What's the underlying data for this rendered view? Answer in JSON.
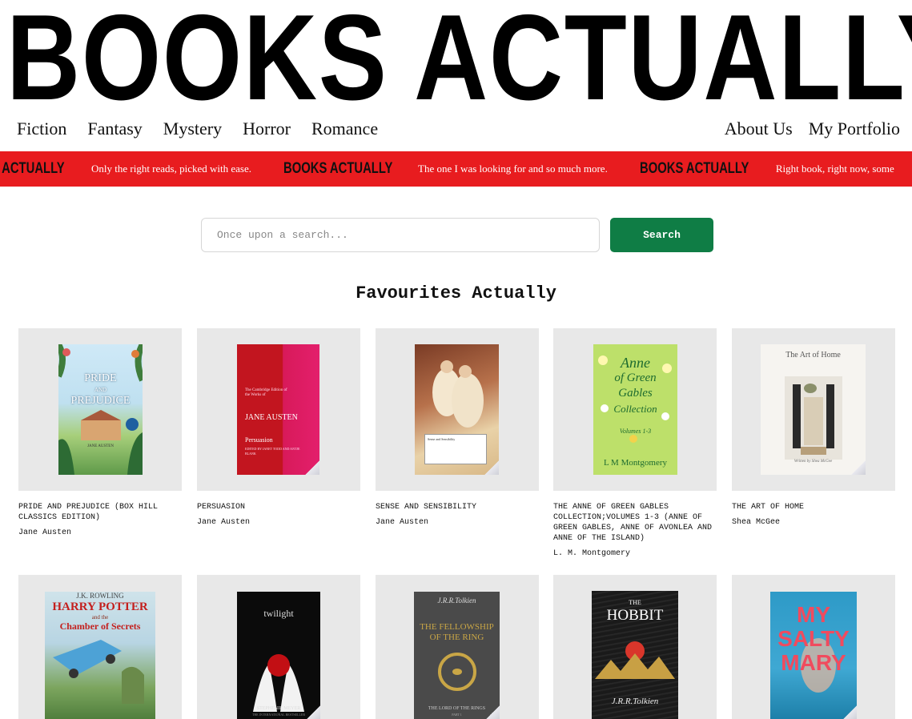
{
  "site": {
    "title": "BOOKS ACTUALLY"
  },
  "nav": {
    "left": [
      "Fiction",
      "Fantasy",
      "Mystery",
      "Horror",
      "Romance"
    ],
    "right": [
      "About Us",
      "My Portfolio"
    ]
  },
  "ticker": {
    "brand": "BOOKS ACTUALLY",
    "brand_partial": "KS ACTUALLY",
    "taglines": [
      "Only the right reads, picked with ease.",
      "The one I was looking for and so much more.",
      "Right book, right now, some"
    ]
  },
  "search": {
    "placeholder": "Once upon a search...",
    "button": "Search"
  },
  "favourites": {
    "title": "Favourites Actually",
    "books": [
      {
        "title": "PRIDE AND PREJUDICE (BOX HILL CLASSICS EDITION)",
        "author": "Jane Austen",
        "cover_text": [
          "PRIDE",
          "AND",
          "PREJUDICE",
          "JANE AUSTEN"
        ]
      },
      {
        "title": "PERSUASION",
        "author": "Jane Austen",
        "cover_text": [
          "The Cambridge Edition of the Works of",
          "JANE AUSTEN",
          "Persuasion",
          "EDITED BY JANET TODD AND ANTJE BLANK"
        ]
      },
      {
        "title": "SENSE AND SENSIBILITY",
        "author": "Jane Austen",
        "cover_text": [
          "Sense and Sensibility"
        ]
      },
      {
        "title": "THE ANNE OF GREEN GABLES COLLECTION;VOLUMES 1-3 (ANNE OF GREEN GABLES, ANNE OF AVONLEA AND ANNE OF THE ISLAND)",
        "author": "L. M. Montgomery",
        "cover_text": [
          "Anne",
          "of Green",
          "Gables",
          "Collection",
          "Volumes 1-3",
          "L M Montgomery"
        ]
      },
      {
        "title": "THE ART OF HOME",
        "author": "Shea McGee",
        "cover_text": [
          "The Art of Home",
          "Written by Shea McGee"
        ]
      },
      {
        "cover_text": [
          "J.K. ROWLING",
          "HARRY POTTER",
          "and the",
          "Chamber of Secrets"
        ]
      },
      {
        "cover_text": [
          "twilight",
          "STEPHENIE MEYER",
          "THE INTERNATIONAL BESTSELLER"
        ]
      },
      {
        "cover_text": [
          "J.R.R.Tolkien",
          "THE FELLOWSHIP",
          "OF THE RING",
          "THE LORD OF THE RINGS",
          "PART 1"
        ]
      },
      {
        "cover_text": [
          "THE",
          "HOBBIT",
          "J.R.R.Tolkien"
        ]
      },
      {
        "cover_text": [
          "MY",
          "SALTY",
          "MARY"
        ]
      }
    ]
  },
  "colors": {
    "ticker": "#e81c1f",
    "button": "#0f7d45",
    "card_bg": "#e8e8e8"
  }
}
